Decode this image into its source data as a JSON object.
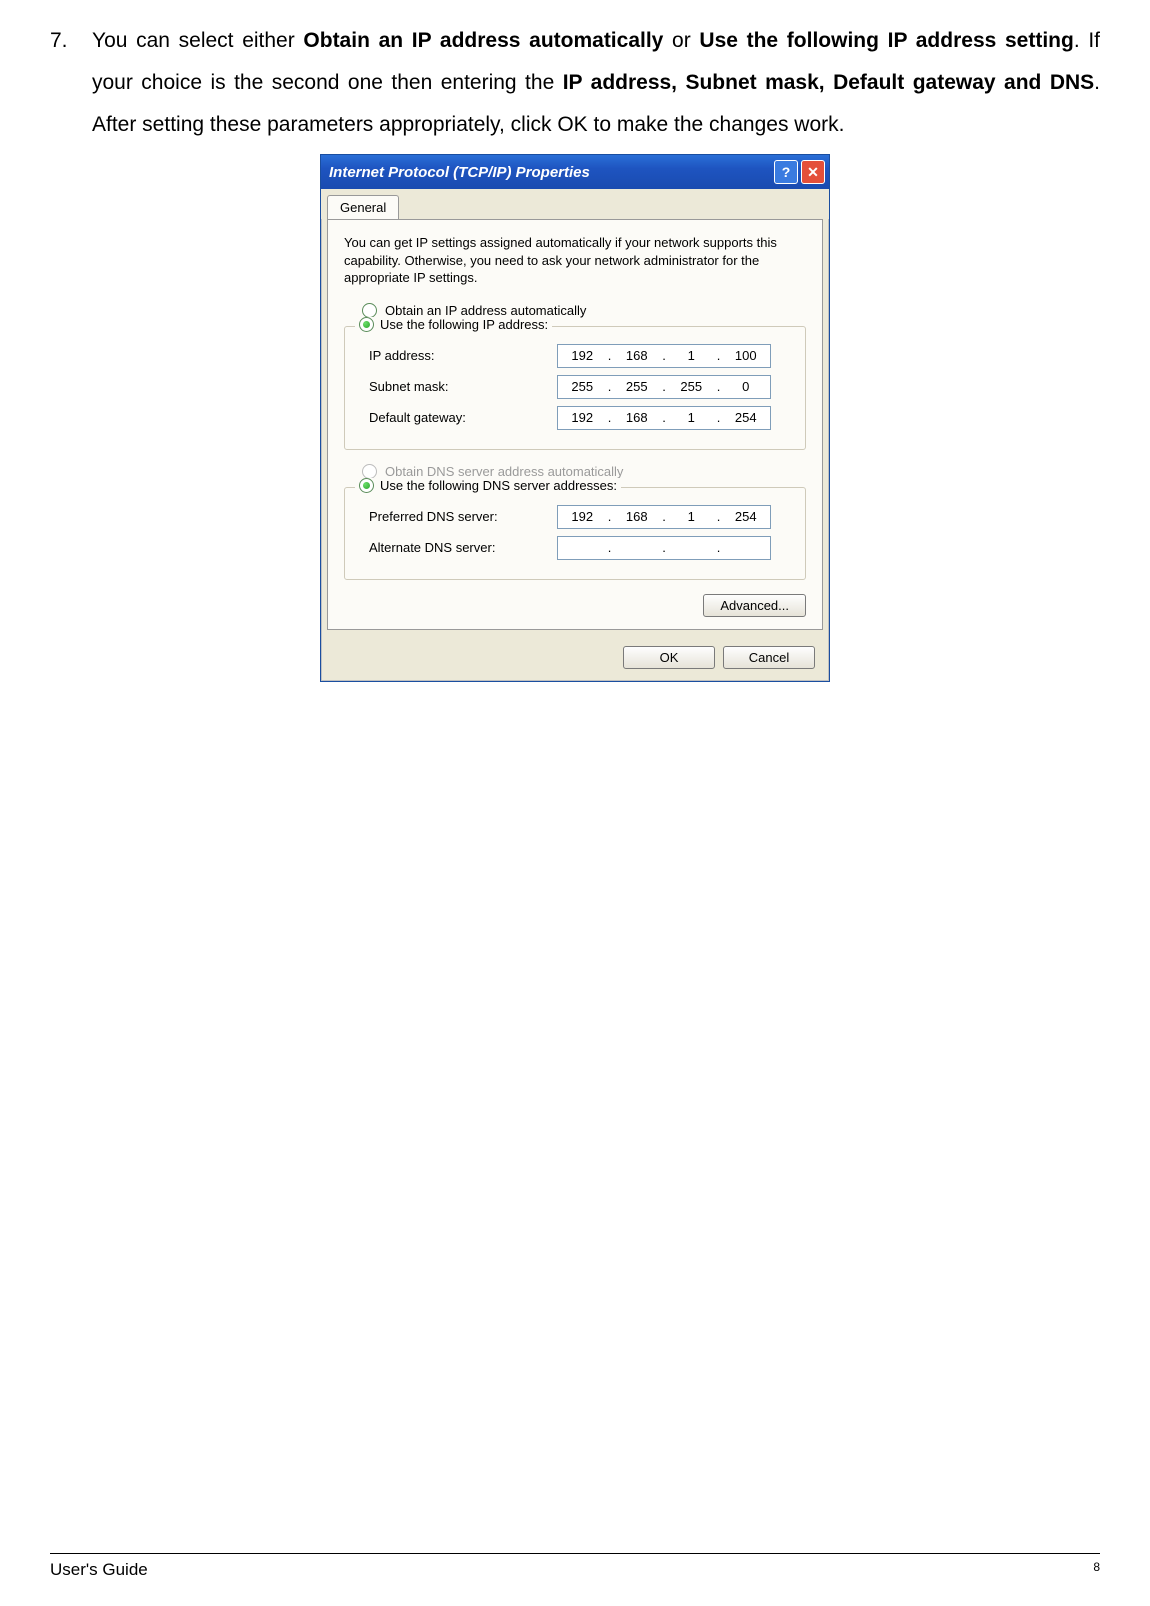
{
  "instruction": {
    "number": "7.",
    "t1": "You can select either ",
    "b1": "Obtain an IP address automatically",
    "t2": " or ",
    "b2": "Use the following IP address setting",
    "t3": ". If your choice is the second one then entering the ",
    "b3": "IP address, Subnet mask, Default gateway and DNS",
    "t4": ". After setting these parameters appropriately, click OK to make the changes work."
  },
  "dialog": {
    "title": "Internet Protocol (TCP/IP) Properties",
    "help": "?",
    "close": "✕",
    "tab": "General",
    "intro": "You can get IP settings assigned automatically if your network supports this capability. Otherwise, you need to ask your network administrator for the appropriate IP settings.",
    "radio_auto_ip": "Obtain an IP address automatically",
    "radio_manual_ip": "Use the following IP address:",
    "ip_label": "IP address:",
    "ip_value": [
      "192",
      "168",
      "1",
      "100"
    ],
    "subnet_label": "Subnet mask:",
    "subnet_value": [
      "255",
      "255",
      "255",
      "0"
    ],
    "gateway_label": "Default gateway:",
    "gateway_value": [
      "192",
      "168",
      "1",
      "254"
    ],
    "radio_auto_dns": "Obtain DNS server address automatically",
    "radio_manual_dns": "Use the following DNS server addresses:",
    "pref_dns_label": "Preferred DNS server:",
    "pref_dns_value": [
      "192",
      "168",
      "1",
      "254"
    ],
    "alt_dns_label": "Alternate DNS server:",
    "alt_dns_value": [
      "",
      "",
      "",
      ""
    ],
    "advanced_btn": "Advanced...",
    "ok_btn": "OK",
    "cancel_btn": "Cancel"
  },
  "footer": {
    "left": "User's Guide",
    "page": "8"
  }
}
